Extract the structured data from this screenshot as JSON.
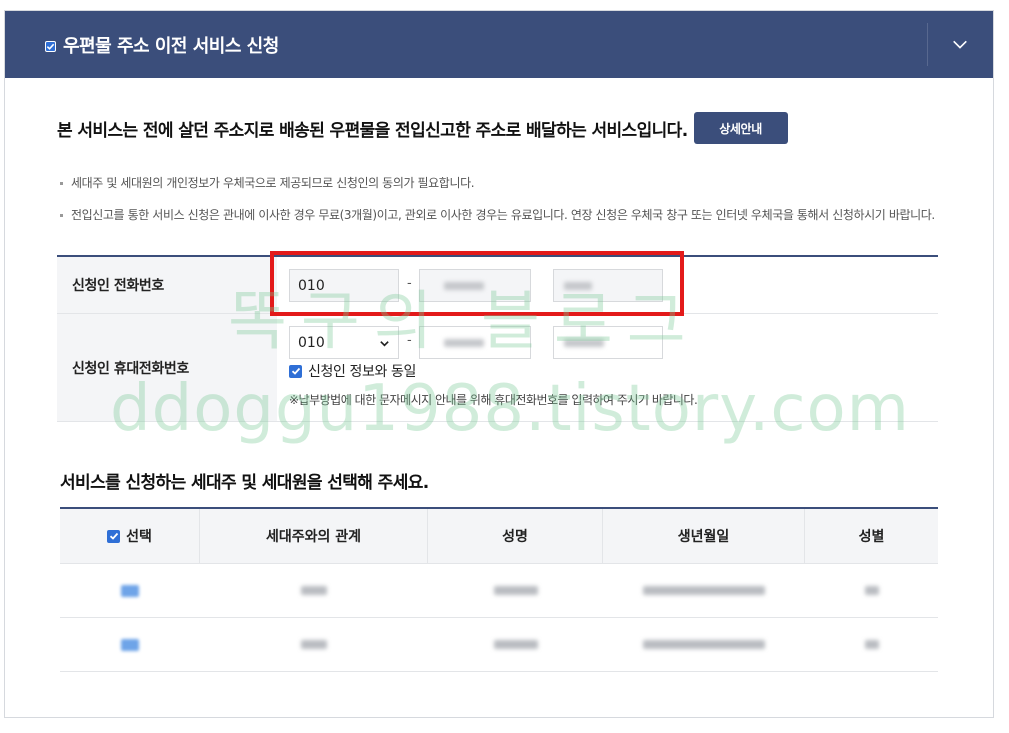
{
  "header": {
    "title": "우편물 주소 이전 서비스 신청"
  },
  "intro": {
    "text": "본 서비스는 전에 살던 주소지로 배송된 우편물을 전입신고한 주소로 배달하는 서비스입니다.",
    "detail_button": "상세안내"
  },
  "notes": [
    "세대주 및 세대원의 개인정보가 우체국으로 제공되므로 신청인의 동의가 필요합니다.",
    "전입신고를 통한 서비스 신청은 관내에 이사한 경우 무료(3개월)이고, 관외로 이사한 경우는 유료입니다. 연장 신청은 우체국 창구 또는 인터넷 우체국을 통해서 신청하시기 바랍니다."
  ],
  "form": {
    "phone": {
      "label": "신청인 전화번호",
      "area_code": "010",
      "separator": "-"
    },
    "mobile": {
      "label": "신청인 휴대전화번호",
      "area_code": "010",
      "separator": "-",
      "same_as_applicant_label": "신청인 정보와 동일",
      "same_as_applicant_checked": true,
      "hint": "※납부방법에 대한 문자메시지 안내를 위해 휴대전화번호를 입력하여 주시기 바랍니다."
    }
  },
  "members": {
    "title": "서비스를 신청하는 세대주 및 세대원을 선택해 주세요.",
    "columns": [
      "선택",
      "세대주와의 관계",
      "성명",
      "생년월일",
      "성별"
    ],
    "row_count": 2
  },
  "watermark": {
    "line1": "똑구의 블로그",
    "line2": "ddoggu1988.tistory.com"
  },
  "colors": {
    "brand_navy": "#3b4e7b",
    "checkbox_blue": "#2f6fd6",
    "highlight_red": "#e31a1a"
  }
}
